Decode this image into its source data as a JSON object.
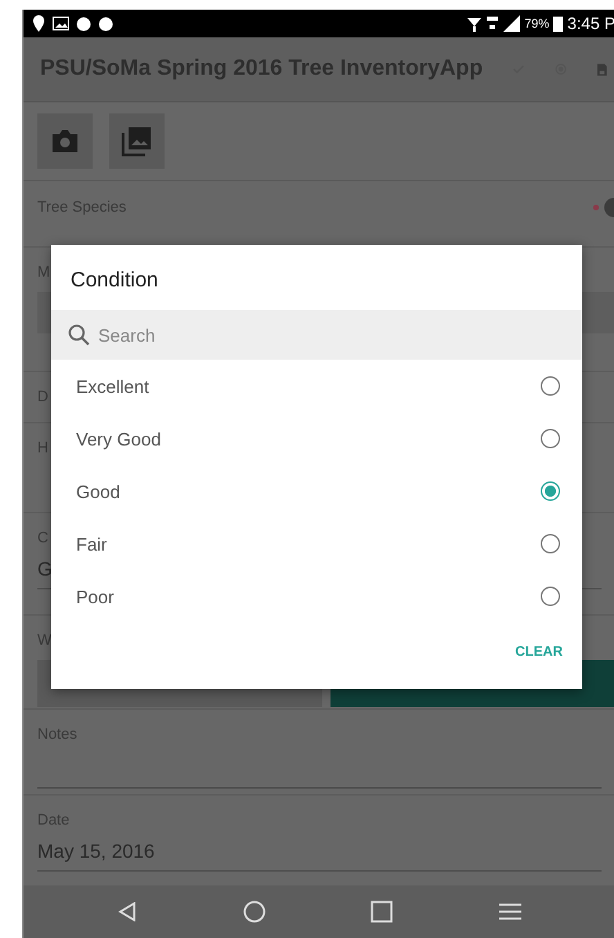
{
  "status_bar": {
    "battery": "79%",
    "time": "3:45 P"
  },
  "app_bar": {
    "title": "PSU/SoMa Spring 2016 Tree InventoryApp"
  },
  "form": [
    {
      "kind": "required",
      "label": "Tree Species"
    },
    {
      "kind": "select",
      "label": "M"
    },
    {
      "kind": "short",
      "label": "D"
    },
    {
      "kind": "tall",
      "label": "H"
    },
    {
      "kind": "value",
      "label": "C",
      "value": "G"
    },
    {
      "kind": "segmented",
      "label": "W"
    },
    {
      "kind": "text",
      "label": "Notes"
    },
    {
      "kind": "value",
      "label": "Date",
      "value": "May 15, 2016"
    }
  ],
  "dialog": {
    "title": "Condition",
    "search": {
      "placeholder": "Search"
    },
    "options": [
      {
        "label": "Excellent",
        "selected": false
      },
      {
        "label": "Very Good",
        "selected": false
      },
      {
        "label": "Good",
        "selected": true
      },
      {
        "label": "Fair",
        "selected": false
      },
      {
        "label": "Poor",
        "selected": false
      }
    ],
    "clear": "CLEAR"
  }
}
